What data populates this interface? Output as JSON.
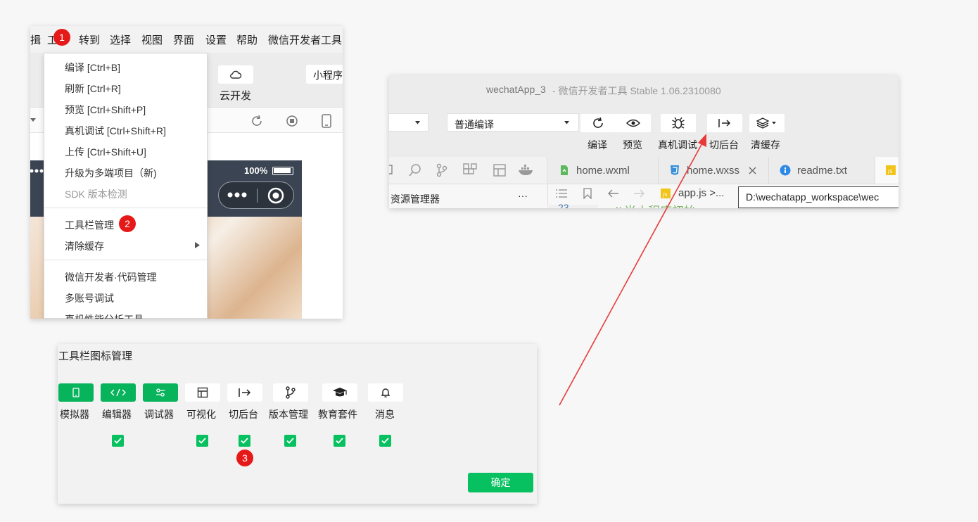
{
  "colors": {
    "accent_green": "#07c160",
    "badge_red": "#e61919",
    "arrow_red": "#e83a3a"
  },
  "panel1": {
    "menubar": [
      "揖",
      "工",
      "转到",
      "选择",
      "视图",
      "界面",
      "设置",
      "帮助",
      "微信开发者工具"
    ],
    "badge1": "1",
    "badge2": "2",
    "cloud_label": "云开发",
    "mini_program_label": "小程序",
    "battery": "100%",
    "menu": [
      {
        "label": "编译  [Ctrl+B]"
      },
      {
        "label": "刷新  [Ctrl+R]"
      },
      {
        "label": "预览  [Ctrl+Shift+P]"
      },
      {
        "label": "真机调试  [Ctrl+Shift+R]"
      },
      {
        "label": "上传  [Ctrl+Shift+U]"
      },
      {
        "label": "升级为多端项目（新)"
      },
      {
        "label": "SDK 版本检测"
      },
      {
        "label": "工具栏管理"
      },
      {
        "label": "清除缓存"
      },
      {
        "label": "微信开发者·代码管理"
      },
      {
        "label": "多账号调试"
      },
      {
        "label": "真机性能分析工具"
      }
    ]
  },
  "panel2": {
    "title": "wechatApp_3",
    "title_suffix": " -  微信开发者工具 Stable 1.06.2310080",
    "compile_mode": "普通编译",
    "toolbar_labels": [
      "编译",
      "预览",
      "真机调试",
      "切后台",
      "清缓存"
    ],
    "tabs": [
      "home.wxml",
      "home.wxss",
      "readme.txt"
    ],
    "explorer_label": "资源管理器",
    "explorer_more": "···",
    "breadcrumb": "app.js >...",
    "line_number": "23",
    "code_snippet": "// 当小程序初始",
    "path_tooltip": "D:\\wechatapp_workspace\\wec"
  },
  "panel3": {
    "title": "工具栏图标管理",
    "items": [
      {
        "label": "模拟器",
        "icon": "phone-icon",
        "active": true,
        "checked": true
      },
      {
        "label": "编辑器",
        "icon": "code-icon",
        "active": true,
        "checked": false
      },
      {
        "label": "调试器",
        "icon": "sliders-icon",
        "active": true,
        "checked": false
      },
      {
        "label": "可视化",
        "icon": "layout-icon",
        "active": false,
        "checked": true
      },
      {
        "label": "切后台",
        "icon": "switch-background-icon",
        "active": false,
        "checked": true
      },
      {
        "label": "版本管理",
        "icon": "git-branch-icon",
        "active": false,
        "checked": true
      },
      {
        "label": "教育套件",
        "icon": "graduation-cap-icon",
        "active": false,
        "checked": true
      },
      {
        "label": "消息",
        "icon": "bell-icon",
        "active": false,
        "checked": true
      }
    ],
    "badge3": "3",
    "confirm": "确定"
  }
}
